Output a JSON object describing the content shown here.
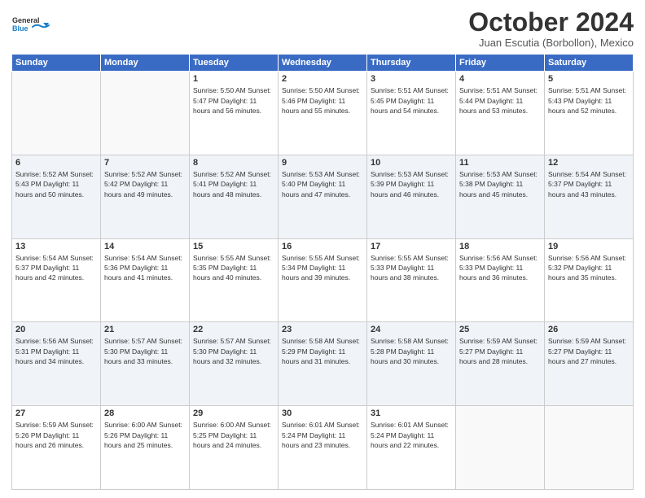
{
  "header": {
    "logo_line1": "General",
    "logo_line2": "Blue",
    "month": "October 2024",
    "location": "Juan Escutia (Borbollon), Mexico"
  },
  "weekdays": [
    "Sunday",
    "Monday",
    "Tuesday",
    "Wednesday",
    "Thursday",
    "Friday",
    "Saturday"
  ],
  "weeks": [
    [
      {
        "day": "",
        "info": ""
      },
      {
        "day": "",
        "info": ""
      },
      {
        "day": "1",
        "info": "Sunrise: 5:50 AM\nSunset: 5:47 PM\nDaylight: 11 hours and 56 minutes."
      },
      {
        "day": "2",
        "info": "Sunrise: 5:50 AM\nSunset: 5:46 PM\nDaylight: 11 hours and 55 minutes."
      },
      {
        "day": "3",
        "info": "Sunrise: 5:51 AM\nSunset: 5:45 PM\nDaylight: 11 hours and 54 minutes."
      },
      {
        "day": "4",
        "info": "Sunrise: 5:51 AM\nSunset: 5:44 PM\nDaylight: 11 hours and 53 minutes."
      },
      {
        "day": "5",
        "info": "Sunrise: 5:51 AM\nSunset: 5:43 PM\nDaylight: 11 hours and 52 minutes."
      }
    ],
    [
      {
        "day": "6",
        "info": "Sunrise: 5:52 AM\nSunset: 5:43 PM\nDaylight: 11 hours and 50 minutes."
      },
      {
        "day": "7",
        "info": "Sunrise: 5:52 AM\nSunset: 5:42 PM\nDaylight: 11 hours and 49 minutes."
      },
      {
        "day": "8",
        "info": "Sunrise: 5:52 AM\nSunset: 5:41 PM\nDaylight: 11 hours and 48 minutes."
      },
      {
        "day": "9",
        "info": "Sunrise: 5:53 AM\nSunset: 5:40 PM\nDaylight: 11 hours and 47 minutes."
      },
      {
        "day": "10",
        "info": "Sunrise: 5:53 AM\nSunset: 5:39 PM\nDaylight: 11 hours and 46 minutes."
      },
      {
        "day": "11",
        "info": "Sunrise: 5:53 AM\nSunset: 5:38 PM\nDaylight: 11 hours and 45 minutes."
      },
      {
        "day": "12",
        "info": "Sunrise: 5:54 AM\nSunset: 5:37 PM\nDaylight: 11 hours and 43 minutes."
      }
    ],
    [
      {
        "day": "13",
        "info": "Sunrise: 5:54 AM\nSunset: 5:37 PM\nDaylight: 11 hours and 42 minutes."
      },
      {
        "day": "14",
        "info": "Sunrise: 5:54 AM\nSunset: 5:36 PM\nDaylight: 11 hours and 41 minutes."
      },
      {
        "day": "15",
        "info": "Sunrise: 5:55 AM\nSunset: 5:35 PM\nDaylight: 11 hours and 40 minutes."
      },
      {
        "day": "16",
        "info": "Sunrise: 5:55 AM\nSunset: 5:34 PM\nDaylight: 11 hours and 39 minutes."
      },
      {
        "day": "17",
        "info": "Sunrise: 5:55 AM\nSunset: 5:33 PM\nDaylight: 11 hours and 38 minutes."
      },
      {
        "day": "18",
        "info": "Sunrise: 5:56 AM\nSunset: 5:33 PM\nDaylight: 11 hours and 36 minutes."
      },
      {
        "day": "19",
        "info": "Sunrise: 5:56 AM\nSunset: 5:32 PM\nDaylight: 11 hours and 35 minutes."
      }
    ],
    [
      {
        "day": "20",
        "info": "Sunrise: 5:56 AM\nSunset: 5:31 PM\nDaylight: 11 hours and 34 minutes."
      },
      {
        "day": "21",
        "info": "Sunrise: 5:57 AM\nSunset: 5:30 PM\nDaylight: 11 hours and 33 minutes."
      },
      {
        "day": "22",
        "info": "Sunrise: 5:57 AM\nSunset: 5:30 PM\nDaylight: 11 hours and 32 minutes."
      },
      {
        "day": "23",
        "info": "Sunrise: 5:58 AM\nSunset: 5:29 PM\nDaylight: 11 hours and 31 minutes."
      },
      {
        "day": "24",
        "info": "Sunrise: 5:58 AM\nSunset: 5:28 PM\nDaylight: 11 hours and 30 minutes."
      },
      {
        "day": "25",
        "info": "Sunrise: 5:59 AM\nSunset: 5:27 PM\nDaylight: 11 hours and 28 minutes."
      },
      {
        "day": "26",
        "info": "Sunrise: 5:59 AM\nSunset: 5:27 PM\nDaylight: 11 hours and 27 minutes."
      }
    ],
    [
      {
        "day": "27",
        "info": "Sunrise: 5:59 AM\nSunset: 5:26 PM\nDaylight: 11 hours and 26 minutes."
      },
      {
        "day": "28",
        "info": "Sunrise: 6:00 AM\nSunset: 5:26 PM\nDaylight: 11 hours and 25 minutes."
      },
      {
        "day": "29",
        "info": "Sunrise: 6:00 AM\nSunset: 5:25 PM\nDaylight: 11 hours and 24 minutes."
      },
      {
        "day": "30",
        "info": "Sunrise: 6:01 AM\nSunset: 5:24 PM\nDaylight: 11 hours and 23 minutes."
      },
      {
        "day": "31",
        "info": "Sunrise: 6:01 AM\nSunset: 5:24 PM\nDaylight: 11 hours and 22 minutes."
      },
      {
        "day": "",
        "info": ""
      },
      {
        "day": "",
        "info": ""
      }
    ]
  ]
}
